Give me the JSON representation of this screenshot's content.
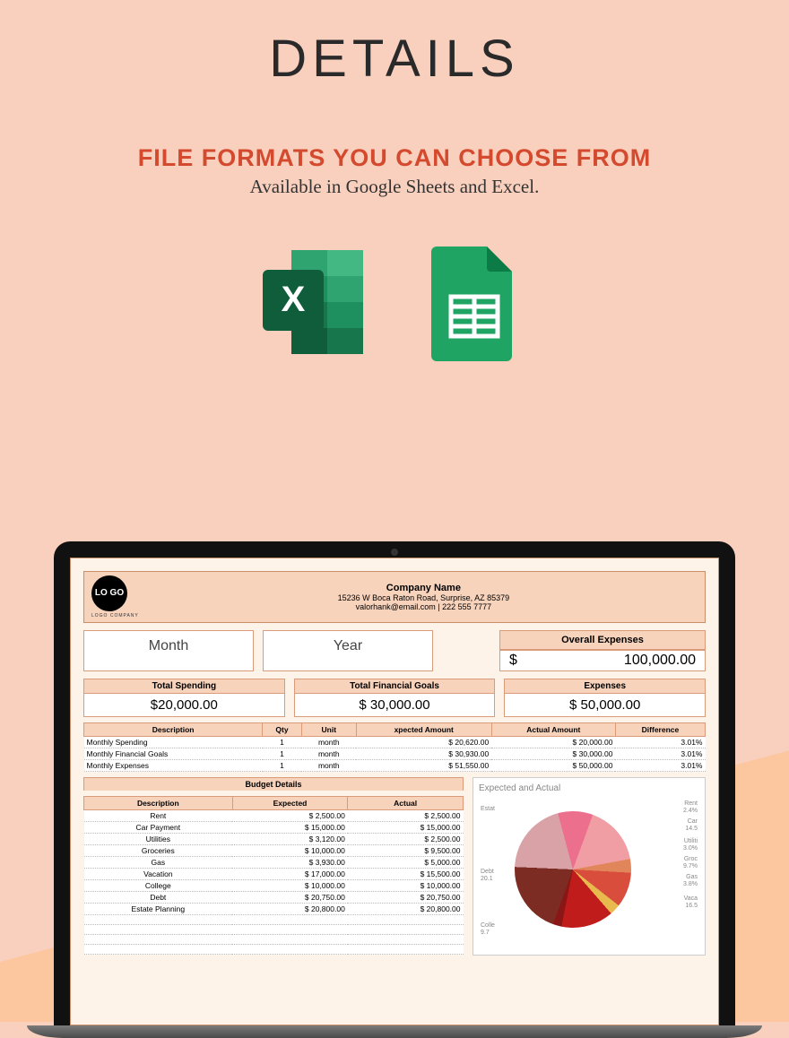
{
  "page": {
    "title": "DETAILS",
    "formats_heading": "FILE FORMATS YOU CAN CHOOSE FROM",
    "formats_sub": "Available in Google Sheets and Excel."
  },
  "icons": {
    "excel": "excel-icon",
    "sheets": "google-sheets-icon"
  },
  "sheet": {
    "logo_text": "LO\nGO",
    "logo_sub": "LOGO COMPANY",
    "company_name": "Company Name",
    "address": "15236 W Boca Raton Road, Surprise, AZ 85379",
    "contact": "valorhank@email.com | 222 555 7777",
    "month_label": "Month",
    "year_label": "Year",
    "overall_label": "Overall Expenses",
    "overall_value": "100,000.00",
    "currency": "$",
    "totals": [
      {
        "label": "Total Spending",
        "value": "$20,000.00"
      },
      {
        "label": "Total Financial Goals",
        "value": "$     30,000.00"
      },
      {
        "label": "Expenses",
        "value": "$     50,000.00"
      }
    ],
    "summary_headers": [
      "Description",
      "Qty",
      "Unit",
      "xpected Amount",
      "Actual Amount",
      "Difference"
    ],
    "summary_rows": [
      {
        "desc": "Monthly Spending",
        "qty": "1",
        "unit": "month",
        "exp": "$    20,620.00",
        "act": "$    20,000.00",
        "diff": "3.01%"
      },
      {
        "desc": "Monthly Financial Goals",
        "qty": "1",
        "unit": "month",
        "exp": "$    30,930.00",
        "act": "$    30,000.00",
        "diff": "3.01%"
      },
      {
        "desc": "Monthly Expenses",
        "qty": "1",
        "unit": "month",
        "exp": "$    51,550.00",
        "act": "$    50,000.00",
        "diff": "3.01%"
      }
    ],
    "budget_title": "Budget Details",
    "budget_headers": [
      "Description",
      "Expected",
      "Actual"
    ],
    "budget_rows": [
      {
        "desc": "Rent",
        "exp": "$      2,500.00",
        "act": "$      2,500.00"
      },
      {
        "desc": "Car Payment",
        "exp": "$    15,000.00",
        "act": "$    15,000.00"
      },
      {
        "desc": "Utilities",
        "exp": "$      3,120.00",
        "act": "$      2,500.00"
      },
      {
        "desc": "Groceries",
        "exp": "$    10,000.00",
        "act": "$      9,500.00"
      },
      {
        "desc": "Gas",
        "exp": "$      3,930.00",
        "act": "$      5,000.00"
      },
      {
        "desc": "Vacation",
        "exp": "$    17,000.00",
        "act": "$    15,500.00"
      },
      {
        "desc": "College",
        "exp": "$    10,000.00",
        "act": "$    10,000.00"
      },
      {
        "desc": "Debt",
        "exp": "$    20,750.00",
        "act": "$    20,750.00"
      },
      {
        "desc": "Estate Planning",
        "exp": "$    20,800.00",
        "act": "$    20,800.00"
      }
    ],
    "chart_title": "Expected and Actual"
  },
  "chart_data": {
    "type": "pie",
    "title": "Expected and Actual",
    "series": [
      {
        "name": "Expected",
        "slices": [
          {
            "label": "Estat",
            "value": 20.1,
            "color": "#7d2c24"
          },
          {
            "label": "Debt",
            "value": 20.1,
            "color": "#d9a2a7"
          },
          {
            "label": "Colle",
            "value": 9.7,
            "color": "#ed6f8e"
          },
          {
            "label": "Vaca",
            "value": 16.5,
            "color": "#f19da4"
          },
          {
            "label": "Gas",
            "value": 3.8,
            "color": "#e0865a"
          },
          {
            "label": "Groc",
            "value": 9.7,
            "color": "#d84d3c"
          },
          {
            "label": "Utiliti",
            "value": 3.0,
            "color": "#e8b94d"
          },
          {
            "label": "Car",
            "value": 14.5,
            "color": "#c11c1c"
          },
          {
            "label": "Rent",
            "value": 2.4,
            "color": "#8a1616"
          }
        ]
      }
    ],
    "labels_left": [
      {
        "name": "Estat",
        "pct": ""
      },
      {
        "name": "Debt",
        "pct": "20.1"
      },
      {
        "name": "Colle",
        "pct": "9.7"
      }
    ],
    "labels_right": [
      {
        "name": "Rent",
        "pct": "2.4%"
      },
      {
        "name": "Car",
        "pct": "14.5"
      },
      {
        "name": "Utiliti",
        "pct": "3.0%"
      },
      {
        "name": "Groc",
        "pct": "9.7%"
      },
      {
        "name": "Gas",
        "pct": "3.8%"
      },
      {
        "name": "Vaca",
        "pct": "16.5"
      }
    ]
  }
}
